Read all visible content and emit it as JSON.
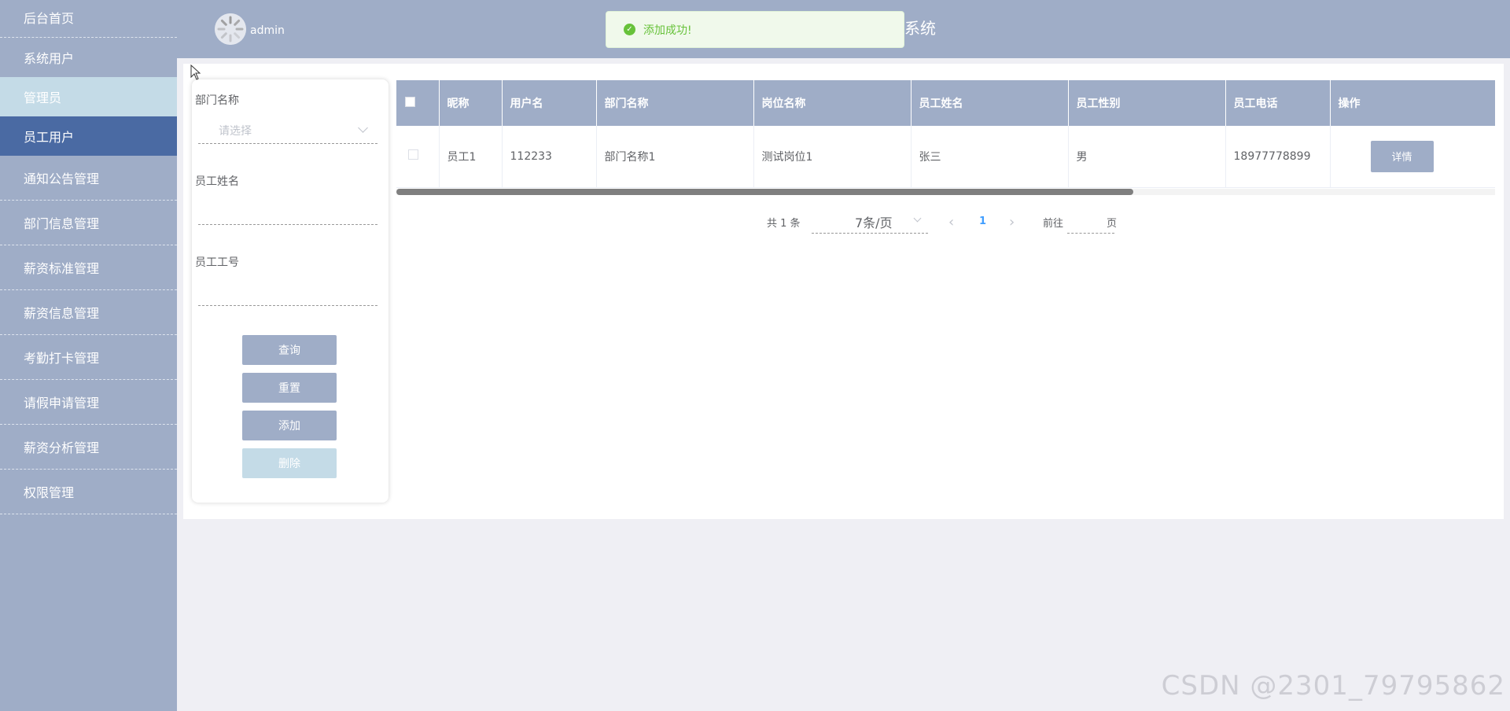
{
  "sidebar": {
    "items": [
      {
        "label": "后台首页"
      },
      {
        "label": "系统用户"
      },
      {
        "label": "管理员"
      },
      {
        "label": "员工用户"
      },
      {
        "label": "通知公告管理"
      },
      {
        "label": "部门信息管理"
      },
      {
        "label": "薪资标准管理"
      },
      {
        "label": "薪资信息管理"
      },
      {
        "label": "考勤打卡管理"
      },
      {
        "label": "请假申请管理"
      },
      {
        "label": "薪资分析管理"
      },
      {
        "label": "权限管理"
      }
    ]
  },
  "header": {
    "username": "admin",
    "title_visible": "系统"
  },
  "toast": {
    "message": "添加成功!",
    "icon": "check-circle-icon",
    "color": "#67c23a"
  },
  "search": {
    "dept_label": "部门名称",
    "dept_placeholder": "请选择",
    "name_label": "员工姓名",
    "name_value": "",
    "id_label": "员工工号",
    "id_value": "",
    "query_label": "查询",
    "reset_label": "重置",
    "add_label": "添加",
    "delete_label": "删除"
  },
  "table": {
    "headers": [
      "昵称",
      "用户名",
      "部门名称",
      "岗位名称",
      "员工姓名",
      "员工性别",
      "员工电话",
      "操作"
    ],
    "rows": [
      {
        "nickname": "员工1",
        "username": "112233",
        "dept": "部门名称1",
        "position": "测试岗位1",
        "name": "张三",
        "gender": "男",
        "phone": "18977778899",
        "action": "详情"
      }
    ]
  },
  "pagination": {
    "total_text": "共 1 条",
    "page_size": "7条/页",
    "current_page": "1",
    "goto_label": "前往",
    "page_suffix": "页"
  },
  "watermark": "CSDN @2301_79795862",
  "colors": {
    "sidebar": "#9fadc7",
    "active": "#4a6aa3",
    "highlight": "#c4dbe7",
    "success": "#67c23a"
  }
}
